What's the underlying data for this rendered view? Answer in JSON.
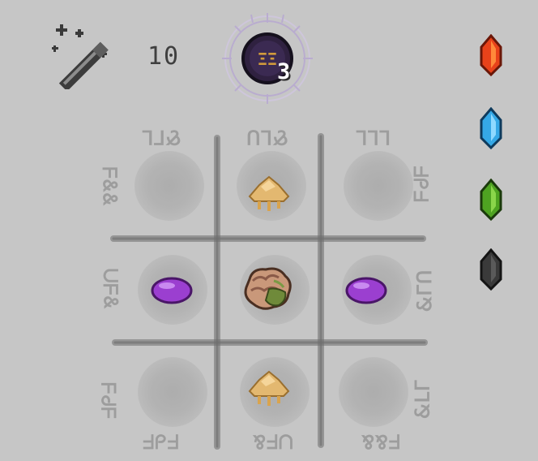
{
  "header": {
    "cost_value": "10",
    "glyph_count": "3",
    "glyph_label": "ΞΞ"
  },
  "crystals": [
    {
      "name": "fire-crystal",
      "color": "#e8421a"
    },
    {
      "name": "water-crystal",
      "color": "#35a8e6"
    },
    {
      "name": "earth-crystal",
      "color": "#4ea321"
    },
    {
      "name": "void-crystal",
      "color": "#3a3a3a"
    }
  ],
  "runes": {
    "top_left": "⅃⅂⅋",
    "top_center": "ᑌ⅃⅋",
    "top_right": "⅃⅃⅃",
    "left_top": "⅋⅋ᖵ",
    "left_middle": "⅋ᖵᑎ",
    "left_bottom": "ᖵᑭᖵ",
    "right_top": "ᖵᑭᖵ",
    "right_middle": "ᑌ⅃⅋",
    "right_bottom": "⅃⅂⅋",
    "bottom_left": "ᖵᑭᖵ",
    "bottom_center": "⅋ᖵᑎ",
    "bottom_right": "⅋⅋ᖵ"
  },
  "grid": {
    "slots": [
      {
        "id": "top-left",
        "item": "empty"
      },
      {
        "id": "top-center",
        "item": "mushroom-cap-icon"
      },
      {
        "id": "top-right",
        "item": "empty"
      },
      {
        "id": "middle-left",
        "item": "purple-gem-icon"
      },
      {
        "id": "center",
        "item": "brain-icon"
      },
      {
        "id": "middle-right",
        "item": "purple-gem-icon"
      },
      {
        "id": "bottom-left",
        "item": "empty"
      },
      {
        "id": "bottom-center",
        "item": "mushroom-cap-icon"
      },
      {
        "id": "bottom-right",
        "item": "empty"
      }
    ]
  },
  "colors": {
    "background": "#c6c6c6",
    "grid_line": "#6e6e6e",
    "rune_text": "#9d9d9d",
    "gem": "#9b3fd0",
    "mushroom": "#e3b870",
    "glyph_disc": "#2f2140",
    "glyph_ring": "#8a7ca6"
  }
}
